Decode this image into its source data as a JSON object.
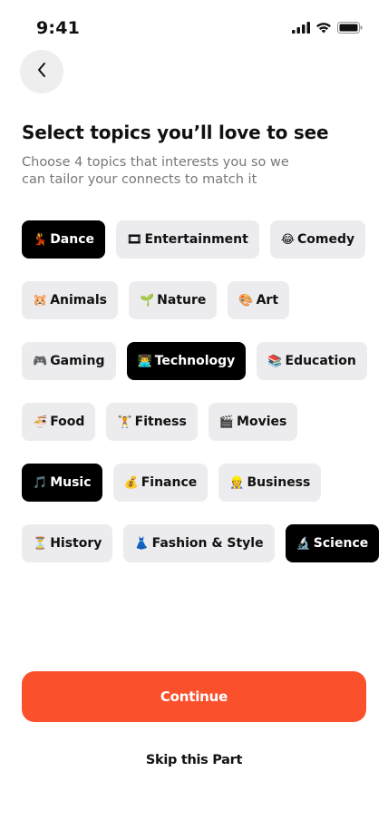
{
  "status_bar": {
    "time": "9:41",
    "icons": [
      "signal-icon",
      "wifi-icon",
      "battery-icon"
    ]
  },
  "header": {
    "back_icon": "chevron-left-icon"
  },
  "title": "Select topics you’ll love to see",
  "subtitle": "Choose 4 topics that interests you so we can tailor your connects to match it",
  "colors": {
    "accent": "#fa512c",
    "chip_default": "#ececef",
    "chip_selected": "#000000"
  },
  "topics": [
    [
      {
        "emoji": "💃",
        "label": "Dance",
        "selected": true
      },
      {
        "emoji": "🎞",
        "label": "Entertainment",
        "selected": false
      },
      {
        "emoji": "😂",
        "label": "Comedy",
        "selected": false
      }
    ],
    [
      {
        "emoji": "🐹",
        "label": "Animals",
        "selected": false
      },
      {
        "emoji": "🌱",
        "label": "Nature",
        "selected": false
      },
      {
        "emoji": "🎨",
        "label": "Art",
        "selected": false
      }
    ],
    [
      {
        "emoji": "🎮",
        "label": "Gaming",
        "selected": false
      },
      {
        "emoji": "👨‍💻",
        "label": "Technology",
        "selected": true
      },
      {
        "emoji": "📚",
        "label": "Education",
        "selected": false
      }
    ],
    [
      {
        "emoji": "🍜",
        "label": "Food",
        "selected": false
      },
      {
        "emoji": "🏋",
        "label": "Fitness",
        "selected": false
      },
      {
        "emoji": "🎬",
        "label": "Movies",
        "selected": false
      }
    ],
    [
      {
        "emoji": "🎵",
        "label": "Music",
        "selected": true
      },
      {
        "emoji": "💰",
        "label": "Finance",
        "selected": false
      },
      {
        "emoji": "👷",
        "label": "Business",
        "selected": false
      }
    ],
    [
      {
        "emoji": "⏳",
        "label": "History",
        "selected": false
      },
      {
        "emoji": "👗",
        "label": "Fashion & Style",
        "selected": false
      },
      {
        "emoji": "🔬",
        "label": "Science",
        "selected": true
      }
    ]
  ],
  "continue_label": "Continue",
  "skip_label": "Skip this Part"
}
